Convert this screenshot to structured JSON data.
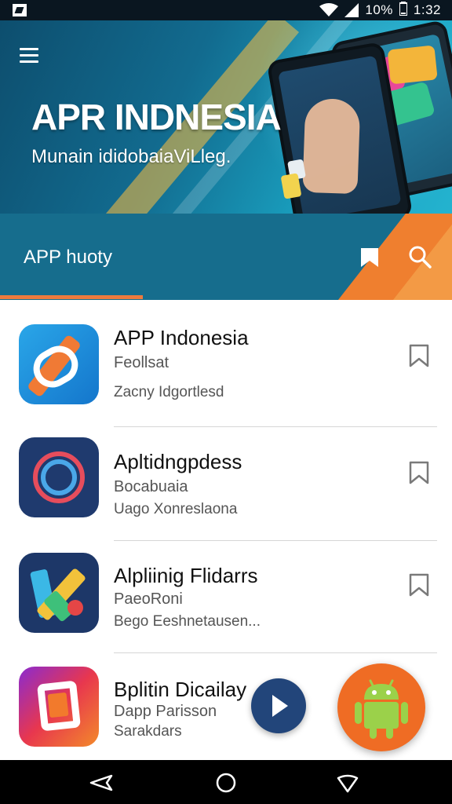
{
  "status_bar": {
    "battery": "10%",
    "time": "1:32"
  },
  "hero": {
    "title": "APR INDNESIA",
    "subtitle": "Munain ididobaiaViLleg."
  },
  "toolbar": {
    "title": "APP huoty"
  },
  "apps": [
    {
      "name": "APP Indonesia",
      "sub1": "Feollsat",
      "sub2": "Zacny Idgortlesd"
    },
    {
      "name": "Apltidngpdess",
      "sub1": "Bocabuaia",
      "sub2": "Uago Xonreslaona"
    },
    {
      "name": "Alpliinig Flidarrs",
      "sub1": "PaeoRoni",
      "sub2": "Bego Eeshnetausen..."
    },
    {
      "name": "Bplitin Dicailay",
      "sub1": "Dapp Parisson",
      "sub2": "Sarakdars"
    }
  ],
  "colors": {
    "toolbar": "#166d8d",
    "accent": "#ee7b3e",
    "fab_play": "#22457a",
    "fab_android": "#ef6c24"
  },
  "icons": {
    "menu": "hamburger-menu-icon",
    "bookmark": "bookmark-icon",
    "search": "search-icon",
    "play": "play-icon",
    "android": "android-icon",
    "back": "back-icon",
    "home": "home-icon",
    "recents": "recents-icon"
  }
}
